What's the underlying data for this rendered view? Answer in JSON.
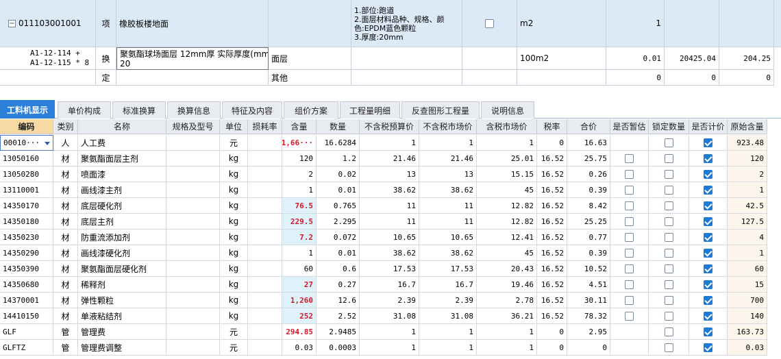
{
  "top_table": {
    "rows": [
      {
        "code": "011103001001",
        "type": "项",
        "name": "橡胶板楼地面",
        "extra": "",
        "features": [
          "1.部位:跑道",
          "2.面层材料品种、规格、颜",
          "色:EPDM蓝色颗粒",
          "3.厚度:20mm"
        ],
        "unit": "m2",
        "qty": "1",
        "c1": "",
        "c2": ""
      },
      {
        "code_line1": "A1-12-114 +",
        "code_line2": "A1-12-115 * 8",
        "type": "换",
        "name_line1": "聚氨酯球场面层 12mm厚  实际厚度(mm):",
        "name_line2": "20",
        "extra": "面层",
        "unit": "100m2",
        "qty": "0.01",
        "c1": "20425.04",
        "c2": "204.25"
      },
      {
        "type": "定",
        "extra": "其他",
        "qty": "0",
        "c1": "0",
        "c2": "0"
      }
    ]
  },
  "tabs": [
    "工料机显示",
    "单价构成",
    "标准换算",
    "换算信息",
    "特征及内容",
    "组价方案",
    "工程量明细",
    "反查图形工程量",
    "说明信息"
  ],
  "grid": {
    "headers": [
      "编码",
      "类别",
      "名称",
      "规格及型号",
      "单位",
      "损耗率",
      "含量",
      "数量",
      "不含税预算价",
      "不含税市场价",
      "含税市场价",
      "税率",
      "合价",
      "是否暂估",
      "锁定数量",
      "是否计价",
      "原始含量"
    ],
    "rows": [
      {
        "code": "00010···",
        "cat": "人",
        "name": "人工费",
        "unit": "元",
        "content": "1,66···",
        "qty": "16.6284",
        "p1": "1",
        "p2": "1",
        "p3": "1",
        "tax": "0",
        "total": "16.63",
        "est": "",
        "lock": false,
        "priced": true,
        "orig": "923.48"
      },
      {
        "code": "13050160",
        "cat": "材",
        "name": "聚氨酯面层主剂",
        "unit": "kg",
        "content": "120",
        "qty": "1.2",
        "p1": "21.46",
        "p2": "21.46",
        "p3": "25.01",
        "tax": "16.52",
        "total": "25.75",
        "est": false,
        "lock": false,
        "priced": true,
        "orig": "120"
      },
      {
        "code": "13050280",
        "cat": "材",
        "name": "喷面漆",
        "unit": "kg",
        "content": "2",
        "qty": "0.02",
        "p1": "13",
        "p2": "13",
        "p3": "15.15",
        "tax": "16.52",
        "total": "0.26",
        "est": false,
        "lock": false,
        "priced": true,
        "orig": "2"
      },
      {
        "code": "13110001",
        "cat": "材",
        "name": "画线漆主剂",
        "unit": "kg",
        "content": "1",
        "qty": "0.01",
        "p1": "38.62",
        "p2": "38.62",
        "p3": "45",
        "tax": "16.52",
        "total": "0.39",
        "est": false,
        "lock": false,
        "priced": true,
        "orig": "1"
      },
      {
        "code": "14350170",
        "cat": "材",
        "name": "底层硬化剂",
        "unit": "kg",
        "content": "76.5",
        "qty": "0.765",
        "p1": "11",
        "p2": "11",
        "p3": "12.82",
        "tax": "16.52",
        "total": "8.42",
        "est": false,
        "lock": false,
        "priced": true,
        "orig": "42.5"
      },
      {
        "code": "14350180",
        "cat": "材",
        "name": "底层主剂",
        "unit": "kg",
        "content": "229.5",
        "qty": "2.295",
        "p1": "11",
        "p2": "11",
        "p3": "12.82",
        "tax": "16.52",
        "total": "25.25",
        "est": false,
        "lock": false,
        "priced": true,
        "orig": "127.5"
      },
      {
        "code": "14350230",
        "cat": "材",
        "name": "防重流添加剂",
        "unit": "kg",
        "content": "7.2",
        "qty": "0.072",
        "p1": "10.65",
        "p2": "10.65",
        "p3": "12.41",
        "tax": "16.52",
        "total": "0.77",
        "est": false,
        "lock": false,
        "priced": true,
        "orig": "4"
      },
      {
        "code": "14350290",
        "cat": "材",
        "name": "画线漆硬化剂",
        "unit": "kg",
        "content": "1",
        "qty": "0.01",
        "p1": "38.62",
        "p2": "38.62",
        "p3": "45",
        "tax": "16.52",
        "total": "0.39",
        "est": false,
        "lock": false,
        "priced": true,
        "orig": "1"
      },
      {
        "code": "14350390",
        "cat": "材",
        "name": "聚氨酯面层硬化剂",
        "unit": "kg",
        "content": "60",
        "qty": "0.6",
        "p1": "17.53",
        "p2": "17.53",
        "p3": "20.43",
        "tax": "16.52",
        "total": "10.52",
        "est": false,
        "lock": false,
        "priced": true,
        "orig": "60"
      },
      {
        "code": "14350680",
        "cat": "材",
        "name": "稀释剂",
        "unit": "kg",
        "content": "27",
        "qty": "0.27",
        "p1": "16.7",
        "p2": "16.7",
        "p3": "19.46",
        "tax": "16.52",
        "total": "4.51",
        "est": false,
        "lock": false,
        "priced": true,
        "orig": "15"
      },
      {
        "code": "14370001",
        "cat": "材",
        "name": "弹性颗粒",
        "unit": "kg",
        "content": "1,260",
        "qty": "12.6",
        "p1": "2.39",
        "p2": "2.39",
        "p3": "2.78",
        "tax": "16.52",
        "total": "30.11",
        "est": false,
        "lock": false,
        "priced": true,
        "orig": "700"
      },
      {
        "code": "14410150",
        "cat": "材",
        "name": "单液粘结剂",
        "unit": "kg",
        "content": "252",
        "qty": "2.52",
        "p1": "31.08",
        "p2": "31.08",
        "p3": "36.21",
        "tax": "16.52",
        "total": "78.32",
        "est": false,
        "lock": false,
        "priced": true,
        "orig": "140"
      },
      {
        "code": "GLF",
        "cat": "管",
        "name": "管理费",
        "unit": "元",
        "content": "294.85",
        "qty": "2.9485",
        "p1": "1",
        "p2": "1",
        "p3": "1",
        "tax": "0",
        "total": "2.95",
        "est": "",
        "lock": false,
        "priced": true,
        "orig": "163.73"
      },
      {
        "code": "GLFTZ",
        "cat": "管",
        "name": "管理费调整",
        "unit": "元",
        "content": "0.03",
        "qty": "0.0003",
        "p1": "1",
        "p2": "1",
        "p3": "1",
        "tax": "0",
        "total": "0",
        "est": "",
        "lock": false,
        "priced": true,
        "orig": "0.03"
      }
    ],
    "highlight_rows": [
      0,
      4,
      5,
      6,
      9,
      10,
      11,
      12
    ]
  },
  "colors": {
    "tab_active": "#2b7fd8",
    "selected_row": "#dce9f7",
    "highlight_cell": "#dff2fa",
    "red_text": "#d7182a",
    "checkbox_on": "#1f7ad6"
  }
}
